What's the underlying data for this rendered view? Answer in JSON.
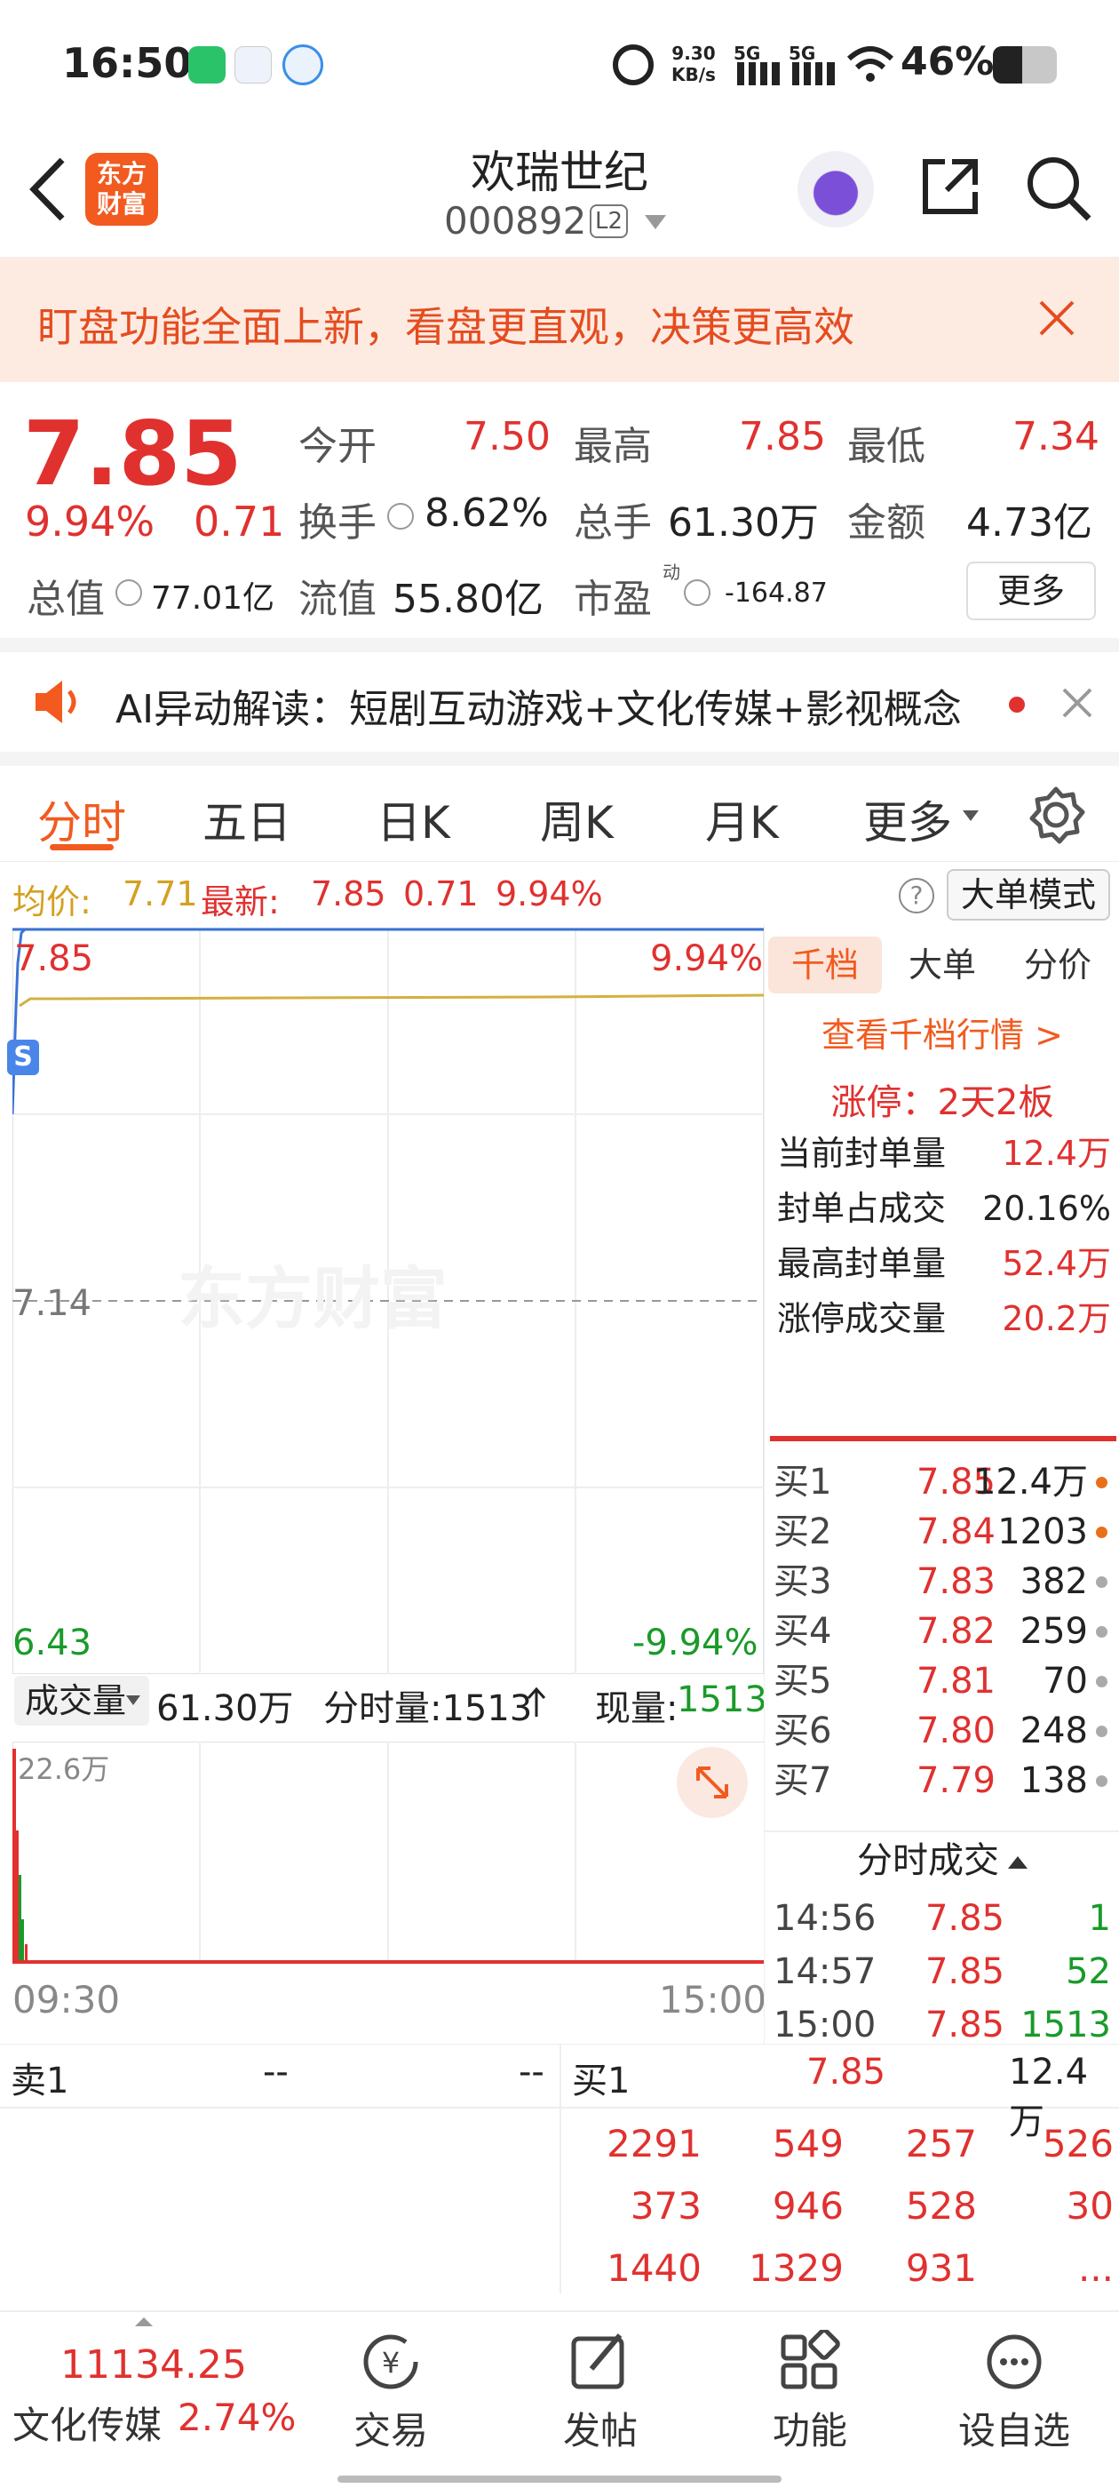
{
  "status_bar": {
    "time": "16:50",
    "net_speed_top": "9.30",
    "net_speed_bottom": "KB/s",
    "sig1": "5G",
    "sig2": "5G",
    "battery": "46%"
  },
  "nav": {
    "logo_line1": "东方",
    "logo_line2": "财富",
    "stock_name": "欢瑞世纪",
    "stock_code": "000892",
    "level_badge": "L2"
  },
  "banner": {
    "text": "盯盘功能全面上新，看盘更直观，决策更高效"
  },
  "quote": {
    "price": "7.85",
    "change_pct": "9.94%",
    "change_amt": "0.71",
    "open_label": "今开",
    "open": "7.50",
    "high_label": "最高",
    "high": "7.85",
    "low_label": "最低",
    "low": "7.34",
    "turnover_label": "换手",
    "turnover": "8.62%",
    "volume_label": "总手",
    "volume": "61.30万",
    "amount_label": "金额",
    "amount": "4.73亿",
    "mktcap_label": "总值",
    "mktcap": "77.01亿",
    "float_label": "流值",
    "float": "55.80亿",
    "pe_label": "市盈",
    "pe_sup": "动",
    "pe": "-164.87",
    "more_button": "更多"
  },
  "ai_bar": {
    "text": "AI异动解读：短剧互动游戏+文化传媒+影视概念"
  },
  "tabs": [
    "分时",
    "五日",
    "日K",
    "周K",
    "月K",
    "更多"
  ],
  "info_line": {
    "avg_label": "均价:",
    "avg": "7.71",
    "latest_label": "最新:",
    "latest": "7.85",
    "chg": "0.71",
    "pct": "9.94%",
    "mode_button": "大单模式"
  },
  "chart": {
    "y_top": "7.85",
    "y_mid": "7.14",
    "y_bot": "6.43",
    "pct_top": "9.94%",
    "pct_bot": "-9.94%",
    "watermark": "东方财富",
    "s_marker": "S",
    "vol_label": "成交量",
    "vol_total": "61.30万",
    "tick_vol": "分时量:1513",
    "cur_vol_label": "现量:",
    "cur_vol": "1513",
    "vol_max": "22.6万",
    "t_start": "09:30",
    "t_end": "15:00"
  },
  "side": {
    "tabs": [
      "千档",
      "大单",
      "分价"
    ],
    "view_link": "查看千档行情 >",
    "limit_up": "涨停：2天2板",
    "metrics": [
      {
        "label": "当前封单量",
        "value": "12.4万"
      },
      {
        "label": "封单占成交",
        "value": "20.16%"
      },
      {
        "label": "最高封单量",
        "value": "52.4万"
      },
      {
        "label": "涨停成交量",
        "value": "20.2万"
      }
    ],
    "orderbook": [
      {
        "k": "买1",
        "p": "7.85",
        "v": "12.4万",
        "dot": "#e8701a"
      },
      {
        "k": "买2",
        "p": "7.84",
        "v": "1203",
        "dot": "#e8701a"
      },
      {
        "k": "买3",
        "p": "7.83",
        "v": "382",
        "dot": "#aaaaaa"
      },
      {
        "k": "买4",
        "p": "7.82",
        "v": "259",
        "dot": "#aaaaaa"
      },
      {
        "k": "买5",
        "p": "7.81",
        "v": "70",
        "dot": "#aaaaaa"
      },
      {
        "k": "买6",
        "p": "7.80",
        "v": "248",
        "dot": "#aaaaaa"
      },
      {
        "k": "买7",
        "p": "7.79",
        "v": "138",
        "dot": "#aaaaaa"
      }
    ],
    "ticks_header": "分时成交",
    "ticks": [
      {
        "t": "14:56",
        "p": "7.85",
        "v": "1"
      },
      {
        "t": "14:57",
        "p": "7.85",
        "v": "52"
      },
      {
        "t": "15:00",
        "p": "7.85",
        "v": "1513"
      }
    ]
  },
  "queue": {
    "sell_label": "卖1",
    "sell_p": "--",
    "sell_v": "--",
    "buy_label": "买1",
    "buy_p": "7.85",
    "buy_v": "12.4万",
    "rows": [
      [
        "2291",
        "549",
        "257",
        "526"
      ],
      [
        "373",
        "946",
        "528",
        "30"
      ],
      [
        "1440",
        "1329",
        "931",
        "..."
      ]
    ]
  },
  "footer": {
    "index_value": "11134.25",
    "index_name": "文化传媒",
    "index_pct": "2.74%",
    "items": [
      "交易",
      "发帖",
      "功能",
      "设自选"
    ]
  },
  "colors": {
    "up": "#e0312f",
    "down": "#1a9a2a",
    "accent": "#f25a1f",
    "avg_line": "#d4b040"
  }
}
